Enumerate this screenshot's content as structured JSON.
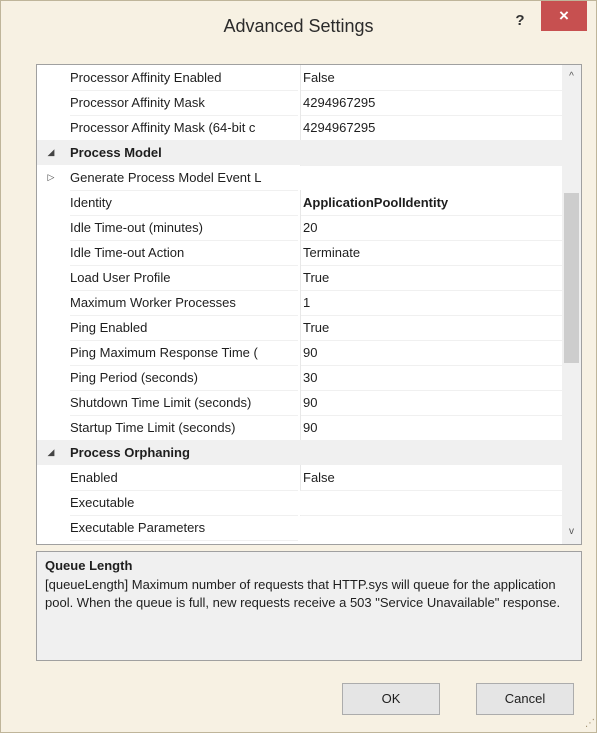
{
  "window": {
    "title": "Advanced Settings",
    "help_label": "?",
    "close_label": "×"
  },
  "grid": {
    "rows": [
      {
        "type": "prop",
        "expander": "",
        "name": "Processor Affinity Enabled",
        "value": "False"
      },
      {
        "type": "prop",
        "expander": "",
        "name": "Processor Affinity Mask",
        "value": "4294967295"
      },
      {
        "type": "prop",
        "expander": "",
        "name": "Processor Affinity Mask (64-bit c",
        "value": "4294967295"
      },
      {
        "type": "category",
        "expander": "◢",
        "name": "Process Model",
        "value": ""
      },
      {
        "type": "prop",
        "expander": "▷",
        "name": "Generate Process Model Event L",
        "value": ""
      },
      {
        "type": "prop",
        "expander": "",
        "name": "Identity",
        "value": "ApplicationPoolIdentity"
      },
      {
        "type": "prop",
        "expander": "",
        "name": "Idle Time-out (minutes)",
        "value": "20"
      },
      {
        "type": "prop",
        "expander": "",
        "name": "Idle Time-out Action",
        "value": "Terminate"
      },
      {
        "type": "prop",
        "expander": "",
        "name": "Load User Profile",
        "value": "True"
      },
      {
        "type": "prop",
        "expander": "",
        "name": "Maximum Worker Processes",
        "value": "1"
      },
      {
        "type": "prop",
        "expander": "",
        "name": "Ping Enabled",
        "value": "True"
      },
      {
        "type": "prop",
        "expander": "",
        "name": "Ping Maximum Response Time (",
        "value": "90"
      },
      {
        "type": "prop",
        "expander": "",
        "name": "Ping Period (seconds)",
        "value": "30"
      },
      {
        "type": "prop",
        "expander": "",
        "name": "Shutdown Time Limit (seconds)",
        "value": "90"
      },
      {
        "type": "prop",
        "expander": "",
        "name": "Startup Time Limit (seconds)",
        "value": "90"
      },
      {
        "type": "category",
        "expander": "◢",
        "name": "Process Orphaning",
        "value": ""
      },
      {
        "type": "prop",
        "expander": "",
        "name": "Enabled",
        "value": "False"
      },
      {
        "type": "prop",
        "expander": "",
        "name": "Executable",
        "value": ""
      },
      {
        "type": "prop",
        "expander": "",
        "name": "Executable Parameters",
        "value": ""
      }
    ],
    "scroll_up_glyph": "^",
    "scroll_down_glyph": "v"
  },
  "description": {
    "title": "Queue Length",
    "text": "[queueLength] Maximum number of requests that HTTP.sys will queue for the application pool. When the queue is full, new requests receive a 503 \"Service Unavailable\" response."
  },
  "buttons": {
    "ok_label": "OK",
    "cancel_label": "Cancel"
  },
  "grip_glyph": "⋰"
}
